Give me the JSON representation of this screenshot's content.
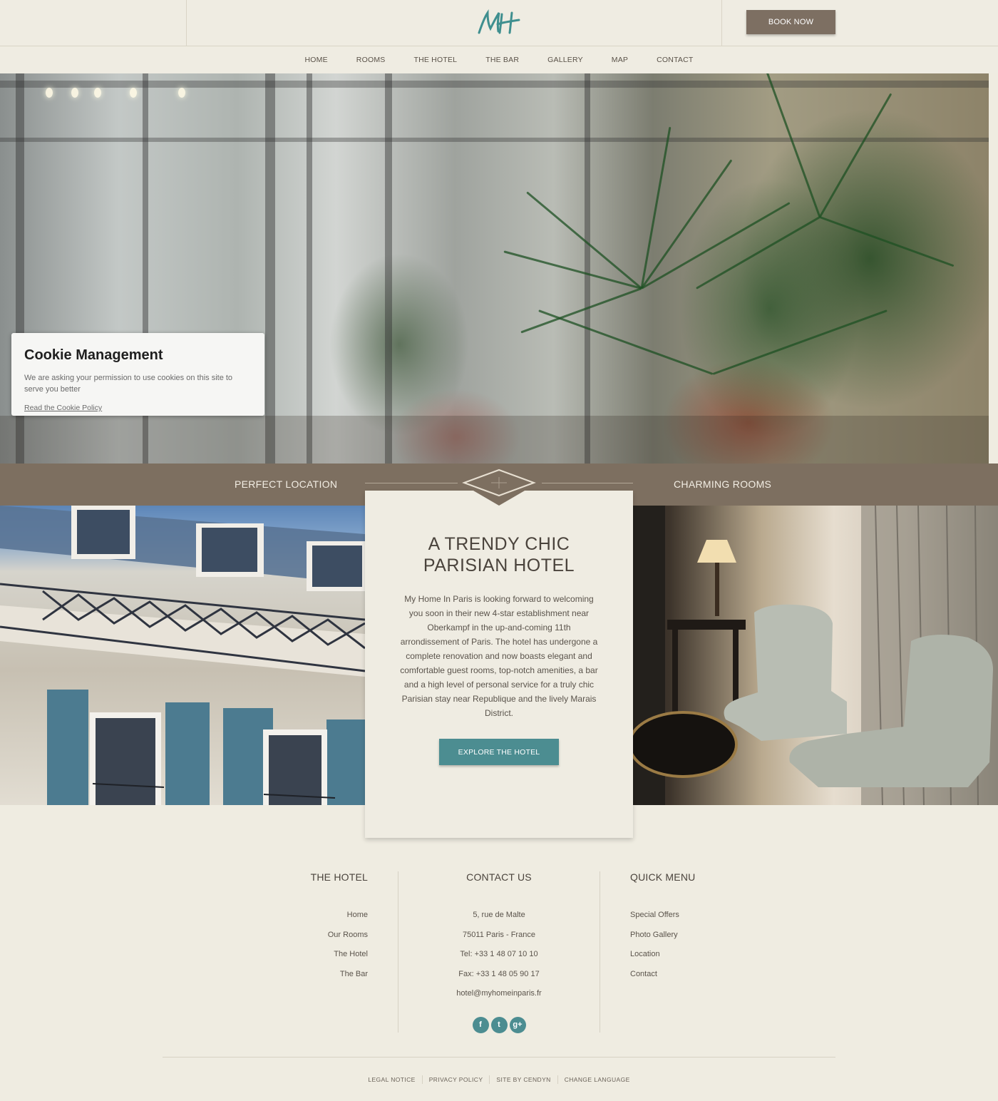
{
  "header": {
    "logo_text": "MH",
    "book_label": "BOOK NOW"
  },
  "nav": {
    "items": [
      "HOME",
      "ROOMS",
      "THE HOTEL",
      "THE BAR",
      "GALLERY",
      "MAP",
      "CONTACT"
    ]
  },
  "cookie": {
    "title": "Cookie Management",
    "text": "We are asking your permission to use cookies on this site to serve you better",
    "link": "Read the Cookie Policy"
  },
  "banner": {
    "left_label": "PERFECT LOCATION",
    "right_label": "CHARMING ROOMS"
  },
  "intro": {
    "title_line1": "A TRENDY CHIC",
    "title_line2": "PARISIAN HOTEL",
    "body": "My Home In Paris is looking forward to welcoming you soon in their new 4-star establishment near Oberkampf in the up-and-coming 11th arrondissement of Paris. The hotel has undergone a complete renovation and now boasts elegant and comfortable guest rooms, top-notch amenities, a bar and a high level of personal service for a truly chic Parisian stay near Republique and the lively Marais District.",
    "cta": "EXPLORE THE HOTEL"
  },
  "footer": {
    "hotel": {
      "heading": "THE HOTEL",
      "links": [
        "Home",
        "Our Rooms",
        "The Hotel",
        "The Bar"
      ]
    },
    "contact": {
      "heading": "CONTACT US",
      "lines": [
        "5, rue de Malte",
        "75011 Paris - France",
        "Tel: +33 1 48 07 10 10",
        "Fax: +33 1 48 05 90 17",
        "hotel@myhomeinparis.fr"
      ],
      "social": [
        "f",
        "t",
        "g+"
      ]
    },
    "quick": {
      "heading": "QUICK MENU",
      "links": [
        "Special Offers",
        "Photo Gallery",
        "Location",
        "Contact"
      ]
    },
    "legal": [
      "LEGAL NOTICE",
      "PRIVACY POLICY",
      "SITE BY CENDYN",
      "CHANGE LANGUAGE"
    ]
  },
  "colors": {
    "accent": "#4c8d91",
    "brown": "#7d6f60",
    "background": "#efece2"
  }
}
